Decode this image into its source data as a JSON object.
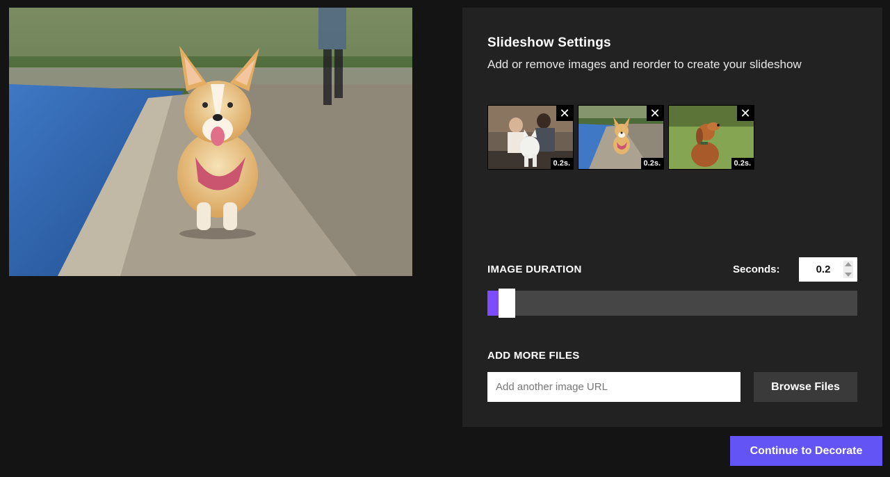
{
  "preview": {
    "icon": "corgi-photo"
  },
  "settings": {
    "title": "Slideshow Settings",
    "subtitle": "Add or remove images and reorder to create your slideshow",
    "thumbnails": [
      {
        "icon": "couple-with-dog-photo",
        "remove": "✕",
        "duration": "0.2s."
      },
      {
        "icon": "corgi-photo",
        "remove": "✕",
        "duration": "0.2s."
      },
      {
        "icon": "golden-retriever-photo",
        "remove": "✕",
        "duration": "0.2s."
      }
    ],
    "image_duration": {
      "label": "IMAGE DURATION",
      "seconds_label": "Seconds:",
      "seconds_value": "0.2",
      "slider_fraction": 0.012,
      "accent_color": "#7c4dff"
    },
    "add_files": {
      "label": "ADD MORE FILES",
      "url_placeholder": "Add another image URL",
      "url_value": "",
      "browse_label": "Browse Files"
    }
  },
  "footer": {
    "continue_label": "Continue to Decorate",
    "continue_color": "#6254f5"
  }
}
